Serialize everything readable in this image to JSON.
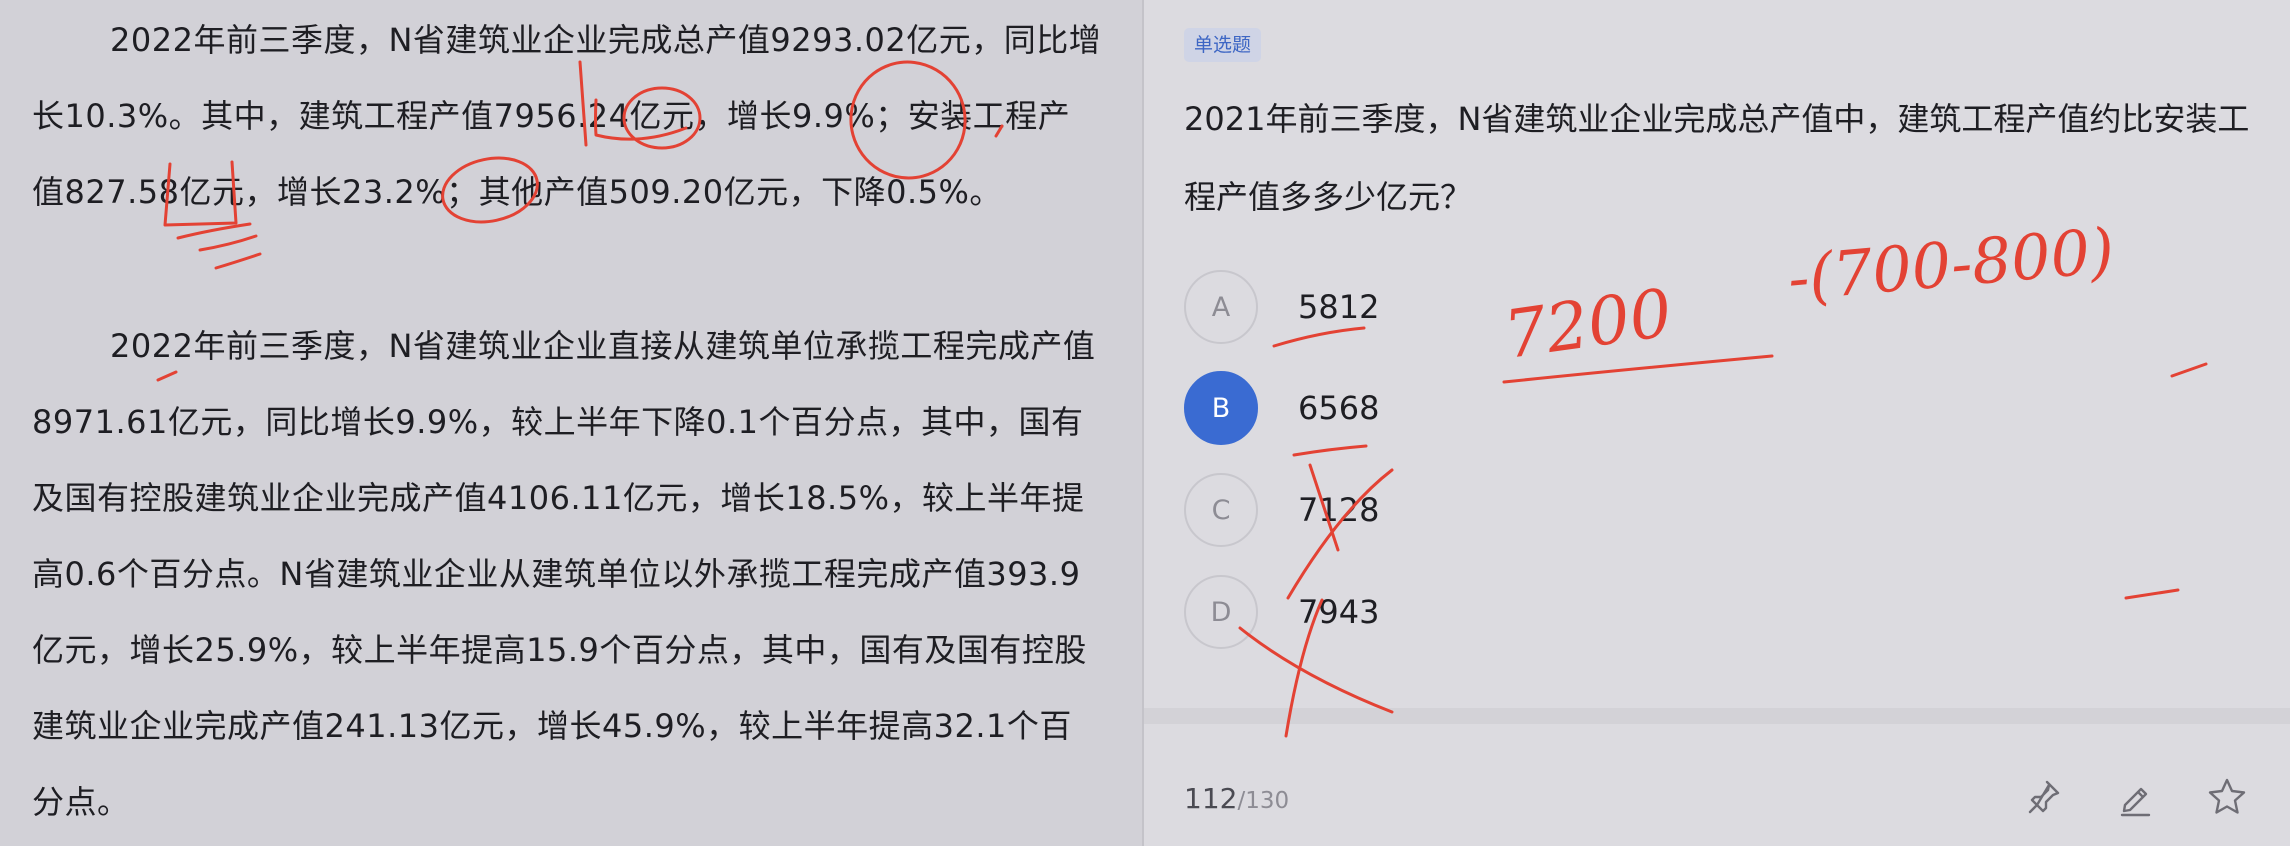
{
  "material": {
    "paragraphs": [
      "2022年前三季度，N省建筑业企业完成总产值9293.02亿元，同比增长10.3%。其中，建筑工程产值7956.24亿元，增长9.9%；安装工程产值827.58亿元，增长23.2%；其他产值509.20亿元，下降0.5%。",
      "2022年前三季度，N省建筑业企业直接从建筑单位承揽工程完成产值8971.61亿元，同比增长9.9%，较上半年下降0.1个百分点，其中，国有及国有控股建筑业企业完成产值4106.11亿元，增长18.5%，较上半年提高0.6个百分点。N省建筑业企业从建筑单位以外承揽工程完成产值393.9亿元，增长25.9%，较上半年提高15.9个百分点，其中，国有及国有控股建筑业企业完成产值241.13亿元，增长45.9%，较上半年提高32.1个百分点。"
    ]
  },
  "question": {
    "type_tag": "单选题",
    "text": "2021年前三季度，N省建筑业企业完成总产值中，建筑工程产值约比安装工程产值多多少亿元？",
    "options": [
      {
        "letter": "A",
        "value": "5812"
      },
      {
        "letter": "B",
        "value": "6568",
        "selected": true
      },
      {
        "letter": "C",
        "value": "7128"
      },
      {
        "letter": "D",
        "value": "7943"
      }
    ]
  },
  "footer": {
    "current": "112",
    "total": "/130",
    "icons": [
      "pin-icon",
      "edit-icon",
      "star-icon"
    ]
  },
  "annotations": {
    "estimate": "7200",
    "formula": "-(700-800)"
  },
  "colors": {
    "selected": "#3a6bd2",
    "ink": "#e34234",
    "tag_text": "#3d66c4"
  }
}
